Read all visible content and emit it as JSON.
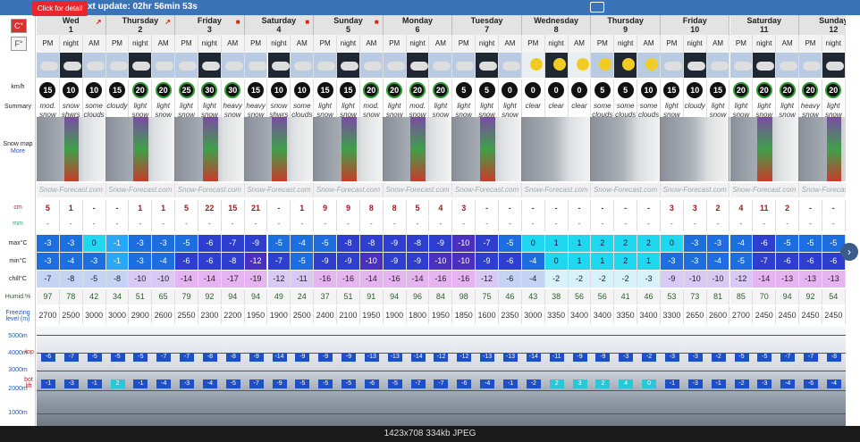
{
  "topbar": {
    "detail_button": "Click for detail",
    "update_text": "xt update: 02hr 56min 53s"
  },
  "units": {
    "c": "C°",
    "f": "F°"
  },
  "row_labels": {
    "wind": "km/h",
    "summary": "Summary",
    "snowmap": "Snow map",
    "more": "More",
    "snow": "cm",
    "rain": "mm",
    "max": "max°C",
    "min": "min°C",
    "chill": "chill°C",
    "humid": "Humid.%",
    "freezing": "Freezing level (m)",
    "alt5000": "5000m",
    "alt4000": "4000m",
    "alt3000": "3000m",
    "alt2000": "2000m",
    "alt1000": "1000m",
    "top_lift": "top",
    "bot_lift": "bot lift"
  },
  "days": [
    {
      "name": "Wed",
      "num": "1",
      "icon": "expand-icon"
    },
    {
      "name": "Thursday",
      "num": "2",
      "icon": "expand-icon"
    },
    {
      "name": "Friday",
      "num": "3",
      "icon": "lock-icon"
    },
    {
      "name": "Saturday",
      "num": "4",
      "icon": "lock-icon"
    },
    {
      "name": "Sunday",
      "num": "5",
      "icon": "lock-icon"
    },
    {
      "name": "Monday",
      "num": "6",
      "icon": ""
    },
    {
      "name": "Tuesday",
      "num": "7",
      "icon": ""
    },
    {
      "name": "Wednesday",
      "num": "8",
      "icon": ""
    },
    {
      "name": "Thursday",
      "num": "9",
      "icon": ""
    },
    {
      "name": "Friday",
      "num": "10",
      "icon": ""
    },
    {
      "name": "Saturday",
      "num": "11",
      "icon": ""
    },
    {
      "name": "Sunday",
      "num": "12",
      "icon": ""
    }
  ],
  "periods": [
    "PM",
    "night",
    "AM",
    "PM",
    "night",
    "AM",
    "PM",
    "night",
    "AM",
    "PM",
    "night",
    "AM",
    "PM",
    "night",
    "AM",
    "PM",
    "night",
    "AM",
    "PM",
    "night",
    "AM",
    "PM",
    "night",
    "AM",
    "PM",
    "night",
    "AM",
    "PM",
    "night",
    "AM",
    "PM",
    "night",
    "AM",
    "PM",
    "night"
  ],
  "wind": [
    "15",
    "10",
    "10",
    "15",
    "20",
    "20",
    "25",
    "30",
    "30",
    "15",
    "10",
    "10",
    "15",
    "15",
    "20",
    "20",
    "20",
    "20",
    "5",
    "5",
    "0",
    "0",
    "0",
    "0",
    "5",
    "5",
    "10",
    "15",
    "10",
    "15",
    "20",
    "20",
    "20",
    "20",
    "20"
  ],
  "summary": [
    "mod. snow",
    "snow shwrs",
    "some clouds",
    "cloudy",
    "light snow",
    "light snow",
    "light snow",
    "light snow",
    "heavy snow",
    "heavy snow",
    "snow shwrs",
    "some clouds",
    "light snow",
    "light snow",
    "mod. snow",
    "light snow",
    "mod. snow",
    "light snow",
    "light snow",
    "light snow",
    "light snow",
    "clear",
    "clear",
    "clear",
    "some clouds",
    "some clouds",
    "some clouds",
    "light snow",
    "cloudy",
    "light snow",
    "light snow",
    "light snow",
    "light snow",
    "heavy snow",
    "light snow"
  ],
  "snow_cm": [
    "5",
    "1",
    "-",
    "-",
    "1",
    "1",
    "5",
    "22",
    "15",
    "21",
    "-",
    "1",
    "9",
    "9",
    "8",
    "8",
    "5",
    "4",
    "3",
    "-",
    "-",
    "-",
    "-",
    "-",
    "-",
    "-",
    "-",
    "3",
    "3",
    "2",
    "4",
    "11",
    "2",
    "-",
    "-"
  ],
  "rain_mm": [
    "-",
    "-",
    "-",
    "-",
    "-",
    "-",
    "-",
    "-",
    "-",
    "-",
    "-",
    "-",
    "-",
    "-",
    "-",
    "-",
    "-",
    "-",
    "-",
    "-",
    "-",
    "-",
    "-",
    "-",
    "-",
    "-",
    "-",
    "-",
    "-",
    "-",
    "-",
    "-",
    "-",
    "-",
    "-"
  ],
  "max_c": [
    "-3",
    "-3",
    "0",
    "-1",
    "-3",
    "-3",
    "-5",
    "-6",
    "-7",
    "-9",
    "-5",
    "-4",
    "-5",
    "-8",
    "-8",
    "-9",
    "-8",
    "-9",
    "-10",
    "-7",
    "-5",
    "0",
    "1",
    "1",
    "2",
    "2",
    "2",
    "0",
    "-3",
    "-3",
    "-4",
    "-6",
    "-5",
    "-5",
    "-5"
  ],
  "min_c": [
    "-3",
    "-4",
    "-3",
    "-1",
    "-3",
    "-4",
    "-6",
    "-6",
    "-8",
    "-12",
    "-7",
    "-5",
    "-9",
    "-9",
    "-10",
    "-9",
    "-9",
    "-10",
    "-10",
    "-9",
    "-6",
    "-4",
    "0",
    "1",
    "1",
    "2",
    "1",
    "-3",
    "-3",
    "-4",
    "-5",
    "-7",
    "-6",
    "-6",
    "-6"
  ],
  "chill_c": [
    "-7",
    "-8",
    "-5",
    "-8",
    "-10",
    "-10",
    "-14",
    "-14",
    "-17",
    "-19",
    "-12",
    "-11",
    "-16",
    "-16",
    "-14",
    "-16",
    "-14",
    "-16",
    "-16",
    "-12",
    "-6",
    "-4",
    "-2",
    "-2",
    "-2",
    "-2",
    "-3",
    "-9",
    "-10",
    "-10",
    "-12",
    "-14",
    "-13",
    "-13",
    "-13"
  ],
  "humid": [
    "97",
    "78",
    "42",
    "34",
    "51",
    "65",
    "79",
    "92",
    "94",
    "94",
    "49",
    "24",
    "37",
    "51",
    "91",
    "94",
    "96",
    "84",
    "98",
    "75",
    "46",
    "43",
    "38",
    "56",
    "56",
    "41",
    "46",
    "53",
    "73",
    "81",
    "85",
    "70",
    "94",
    "92",
    "54"
  ],
  "freezing": [
    "2700",
    "2500",
    "3000",
    "3000",
    "2900",
    "2600",
    "2550",
    "2300",
    "2200",
    "1950",
    "1900",
    "2500",
    "2400",
    "2100",
    "1950",
    "1900",
    "1800",
    "1950",
    "1850",
    "1600",
    "2350",
    "3000",
    "3350",
    "3400",
    "3400",
    "3350",
    "3400",
    "3300",
    "2650",
    "2600",
    "2700",
    "2450",
    "2450",
    "2450",
    "2450"
  ],
  "top_lift": [
    "-6",
    "-7",
    "-5",
    "-5",
    "-5",
    "-7",
    "-7",
    "-8",
    "-8",
    "-9",
    "-14",
    "-9",
    "-9",
    "-9",
    "-13",
    "-13",
    "-14",
    "-12",
    "-12",
    "-13",
    "-13",
    "-14",
    "-11",
    "-9",
    "-9",
    "-3",
    "-2",
    "-3",
    "-3",
    "-2",
    "-5",
    "-5",
    "-7",
    "-7",
    "-8"
  ],
  "bot_lift": [
    "-1",
    "-3",
    "-1",
    "2",
    "-1",
    "-4",
    "-3",
    "-4",
    "-5",
    "-7",
    "-9",
    "-5",
    "-5",
    "-5",
    "-6",
    "-5",
    "-7",
    "-7",
    "-6",
    "-4",
    "-1",
    "-2",
    "2",
    "3",
    "2",
    "4",
    "0",
    "-1",
    "-3",
    "-1",
    "-2",
    "-3",
    "-4",
    "-6",
    "-4"
  ],
  "logo_text": "Snow-Forecast.com",
  "footer": "1423x708 334kb JPEG",
  "colors": {
    "brand": "#3b73b8",
    "button_red": "#e8262b",
    "snow": "#9c1a1a"
  }
}
